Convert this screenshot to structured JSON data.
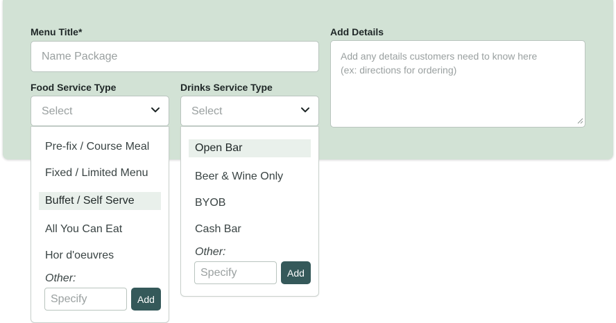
{
  "form": {
    "menu_title": {
      "label": "Menu Title*",
      "placeholder": "Name Package"
    },
    "details": {
      "label": "Add Details",
      "placeholder": "Add any details customers need to know here\n(ex: directions for ordering)"
    },
    "food": {
      "label": "Food Service Type",
      "select_text": "Select",
      "options": [
        "Pre-fix / Course Meal",
        "Fixed / Limited Menu",
        "Buffet / Self Serve",
        "All You Can Eat",
        "Hor d'oeuvres"
      ],
      "highlighted": "Buffet / Self Serve",
      "other_label": "Other:",
      "other_placeholder": "Specify",
      "add_label": "Add"
    },
    "drinks": {
      "label": "Drinks Service Type",
      "select_text": "Select",
      "options": [
        "Open Bar",
        "Beer & Wine Only",
        "BYOB",
        "Cash Bar"
      ],
      "highlighted": "Open Bar",
      "other_label": "Other:",
      "other_placeholder": "Specify",
      "add_label": "Add"
    }
  },
  "colors": {
    "panel_bg": "#d2e2d5",
    "button_bg": "#35595a",
    "highlight_bg": "#e9f0eb"
  }
}
